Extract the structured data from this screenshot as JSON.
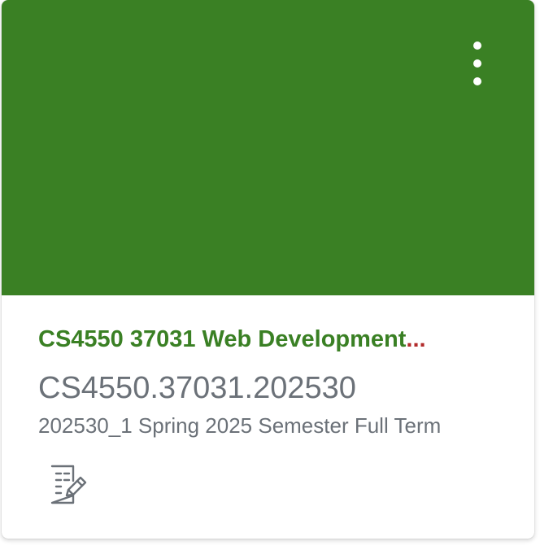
{
  "card": {
    "hero_color": "#3a8024",
    "menu_icon": "kebab-vertical-icon",
    "title": "CS4550 37031 Web Development",
    "title_ellipsis": "...",
    "course_code": "CS4550.37031.202530",
    "term": "202530_1 Spring 2025 Semester Full Term",
    "action_icon": "assignments-icon"
  }
}
